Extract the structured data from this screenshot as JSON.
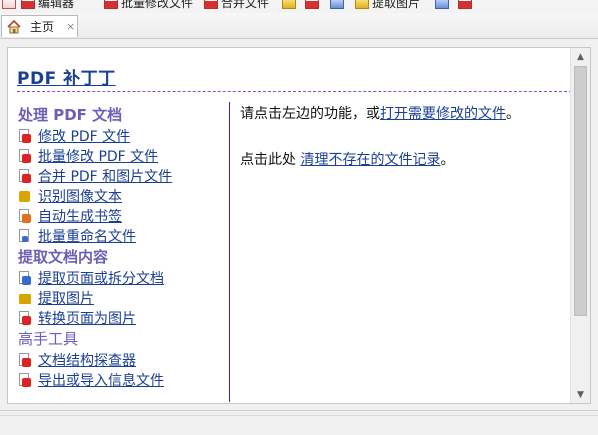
{
  "toolbar": {
    "items": [
      {
        "label": "编辑器",
        "icon": "editor-icon"
      },
      {
        "label": "批量修改文件",
        "icon": "batch-edit-icon"
      },
      {
        "label": "合并文件",
        "icon": "merge-icon"
      },
      {
        "label": "",
        "icon": "ocr-icon"
      },
      {
        "label": "",
        "icon": "bookmark-icon"
      },
      {
        "label": "",
        "icon": "rename-icon"
      },
      {
        "label": "提取图片",
        "icon": "extract-image-icon"
      },
      {
        "label": "",
        "icon": "tool-icon"
      },
      {
        "label": "",
        "icon": "export-icon"
      }
    ]
  },
  "tabs": [
    {
      "label": "主页",
      "icon": "home-icon",
      "close": "×"
    }
  ],
  "page": {
    "title": "PDF 补丁丁",
    "sections": [
      {
        "heading": "处理 PDF 文档",
        "items": [
          {
            "label": "修改 PDF 文件",
            "icon": "pdf-edit-icon",
            "color": "red"
          },
          {
            "label": "批量修改 PDF 文件",
            "icon": "pdf-batch-icon",
            "color": "red"
          },
          {
            "label": "合并 PDF 和图片文件",
            "icon": "pdf-merge-icon",
            "color": "red"
          },
          {
            "label": "识别图像文本",
            "icon": "ocr-icon",
            "color": "gold"
          },
          {
            "label": "自动生成书签",
            "icon": "bookmark-icon",
            "color": "orange"
          },
          {
            "label": "批量重命名文件",
            "icon": "rename-icon",
            "color": "blue"
          }
        ]
      },
      {
        "heading": "提取文档内容",
        "items": [
          {
            "label": "提取页面或拆分文档",
            "icon": "split-icon",
            "color": "blue"
          },
          {
            "label": "提取图片",
            "icon": "image-icon",
            "color": "gold"
          },
          {
            "label": "转换页面为图片",
            "icon": "page-to-image-icon",
            "color": "red"
          }
        ]
      },
      {
        "heading": "高手工具",
        "items": [
          {
            "label": "文档结构探查器",
            "icon": "inspector-icon",
            "color": "red"
          },
          {
            "label": "导出或导入信息文件",
            "icon": "import-export-icon",
            "color": "red"
          }
        ]
      }
    ],
    "right": {
      "line1_prefix": "请点击左边的功能，或",
      "line1_link": "打开需要修改的文件",
      "line1_suffix": "。",
      "line2_prefix": "点击此处 ",
      "line2_link": "清理不存在的文件记录",
      "line2_suffix": "。"
    }
  },
  "scrollbar": {
    "up": "▲",
    "down": "▼"
  }
}
